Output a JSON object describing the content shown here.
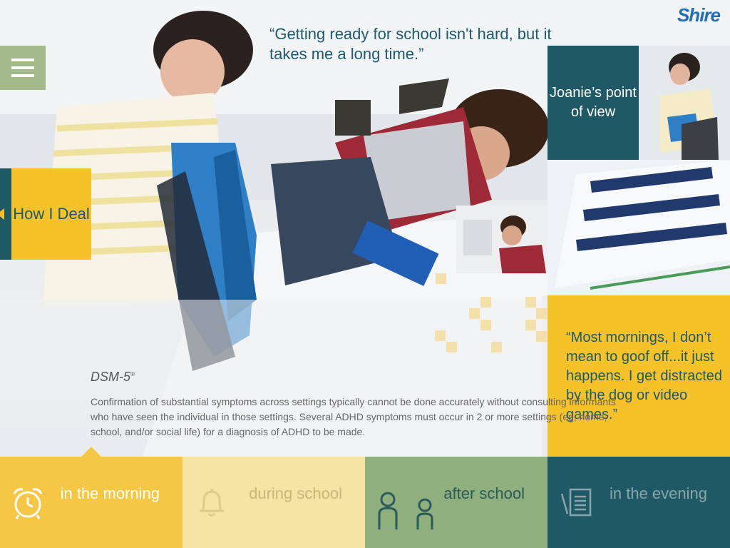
{
  "brand": {
    "logo": "Shire"
  },
  "quote_top": "“Getting ready for school isn't hard, but it takes me a long time.”",
  "menu": {
    "icon": "hamburger-icon"
  },
  "pov": {
    "label": "Joanie’s point of view"
  },
  "deal": {
    "label": "How I Deal"
  },
  "quote_side": "“Most mornings, I don’t mean to goof off...it just happens. I get distracted by the dog or video games.”",
  "dsm": {
    "title": "DSM-5",
    "title_mark": "®",
    "body": "Confirmation of substantial symptoms across settings typically cannot be done accurately without consulting informants who have seen the individual in those settings. Several ADHD symptoms must occur in 2 or more settings (eg, home, school, and/or social life) for a diagnosis of ADHD to be made."
  },
  "tabs": [
    {
      "label": "in the morning",
      "icon": "alarm-clock-icon",
      "color": "#f6c745",
      "active": true
    },
    {
      "label": "during school",
      "icon": "bell-icon",
      "color": "#f5e4a4",
      "active": false
    },
    {
      "label": "after school",
      "icon": "people-icon",
      "color": "#8fb07e",
      "active": false
    },
    {
      "label": "in the evening",
      "icon": "notepad-icon",
      "color": "#1e5965",
      "active": false
    }
  ],
  "colors": {
    "teal": "#1e5965",
    "yellow": "#f6c22a",
    "green": "#a3b98a"
  }
}
